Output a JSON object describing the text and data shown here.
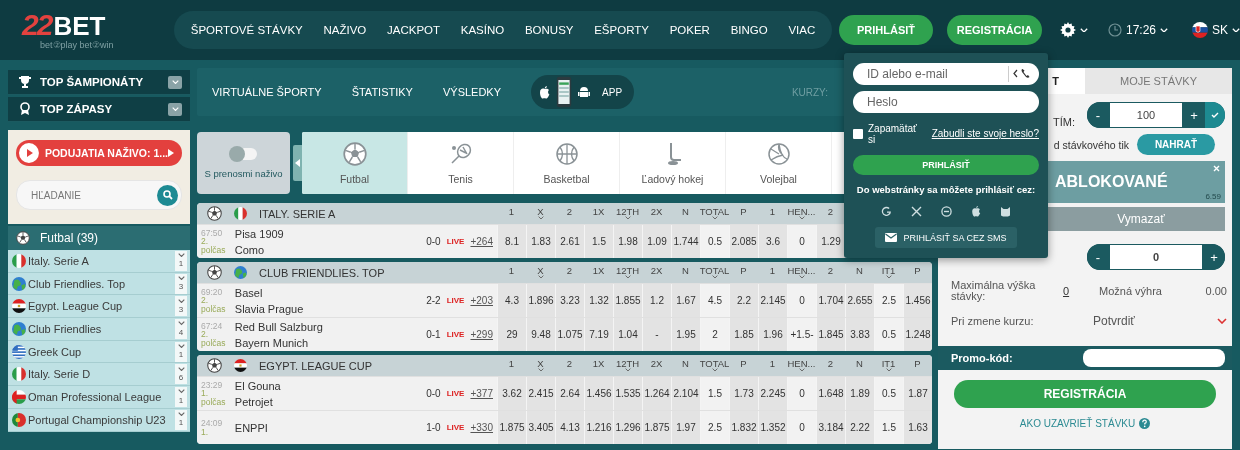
{
  "header": {
    "logo": {
      "mark": "22",
      "name": "BET",
      "tagline": "bet②play bet②win"
    },
    "nav": [
      "ŠPORTOVÉ STÁVKY",
      "NAŽIVO",
      "JACKPOT",
      "KASÍNO",
      "BONUSY",
      "EŠPORTY",
      "POKER",
      "BINGO",
      "VIAC"
    ],
    "login_button": "PRIHLÁSIŤ",
    "register_button": "REGISTRÁCIA",
    "time": "17:26",
    "language": "SK"
  },
  "login_popup": {
    "id_placeholder": "ID alebo e-mail",
    "password_placeholder": "Heslo",
    "remember": {
      "label": "Zapamätať si",
      "checked": false
    },
    "forgot_link": "Zabudli ste svoje heslo?",
    "submit": "PRIHLÁSIŤ",
    "social_caption": "Do webstránky sa môžete prihlásiť cez:",
    "sms_button": "PRIHLÁSIŤ SA CEZ SMS"
  },
  "sidebar": {
    "top": [
      {
        "label": "TOP ŠAMPIONÁTY",
        "kind": "trophy"
      },
      {
        "label": "TOP ZÁPASY",
        "kind": "medal"
      }
    ],
    "live_button": "PODUJATIA NAŽIVO: 1...",
    "search": {
      "placeholder": "HĽADANIE"
    },
    "sport": "Futbal (39)",
    "leagues": [
      {
        "name": "Italy. Serie A",
        "kind": "italy",
        "count": "1"
      },
      {
        "name": "Club Friendlies. Top",
        "kind": "world",
        "count": "3"
      },
      {
        "name": "Egypt. League Cup",
        "kind": "egypt",
        "count": "3"
      },
      {
        "name": "Club Friendlies",
        "kind": "world",
        "count": "4"
      },
      {
        "name": "Greek Cup",
        "kind": "greece",
        "count": "1"
      },
      {
        "name": "Italy. Serie D",
        "kind": "italy",
        "count": "6"
      },
      {
        "name": "Oman Professional League",
        "kind": "oman",
        "count": "1"
      },
      {
        "name": "Portugal Championship U23",
        "kind": "portugal",
        "count": "1"
      }
    ]
  },
  "subnav": {
    "links": [
      "VIRTUÁLNE ŠPORTY",
      "ŠTATISTIKY",
      "VÝSLEDKY"
    ],
    "app": "APP",
    "odds_label": "KURZY:"
  },
  "sports": {
    "live_toggle": {
      "label": "S prenosmi naživo",
      "on": false
    },
    "tabs": [
      {
        "label": "Futbal",
        "kind": "soccer",
        "selected": true
      },
      {
        "label": "Tenis",
        "kind": "tennis",
        "selected": false
      },
      {
        "label": "Basketbal",
        "kind": "basketball",
        "selected": false
      },
      {
        "label": "Ľadový hokej",
        "kind": "hockey",
        "selected": false
      },
      {
        "label": "Volejbal",
        "kind": "volleyball",
        "selected": false
      }
    ]
  },
  "groups": [
    {
      "name": "ITALY. SERIE A",
      "kind": "italy",
      "columns": [
        {
          "label": "1",
          "dropdown": false,
          "kind": "odds"
        },
        {
          "label": "X",
          "dropdown": true,
          "kind": "odds"
        },
        {
          "label": "2",
          "dropdown": false,
          "kind": "odds"
        },
        {
          "label": "1X",
          "dropdown": false,
          "kind": "odds"
        },
        {
          "label": "12TH",
          "dropdown": true,
          "kind": "odds"
        },
        {
          "label": "2X",
          "dropdown": false,
          "kind": "odds"
        },
        {
          "label": "N",
          "dropdown": false,
          "kind": "odds"
        },
        {
          "label": "TOTAL",
          "dropdown": true,
          "kind": "param"
        },
        {
          "label": "P",
          "dropdown": false,
          "kind": "odds"
        },
        {
          "label": "1",
          "dropdown": false,
          "kind": "odds"
        },
        {
          "label": "HEN...",
          "dropdown": true,
          "kind": "param"
        },
        {
          "label": "2",
          "dropdown": false,
          "kind": "odds"
        }
      ],
      "matches": [
        {
          "time": "67:50",
          "period": "2. polčas",
          "home": "Pisa 1909",
          "away": "Como",
          "score": "0-0",
          "live": "LIVE",
          "markets": "+264",
          "odds": [
            "8.1",
            "1.83",
            "2.61",
            "1.5",
            "1.98",
            "1.09",
            "1.744",
            "0.5",
            "2.085",
            "3.6",
            "0",
            "1.29"
          ]
        }
      ]
    },
    {
      "name": "CLUB FRIENDLIES. TOP",
      "kind": "world",
      "columns": [
        {
          "label": "1",
          "dropdown": false,
          "kind": "odds"
        },
        {
          "label": "X",
          "dropdown": true,
          "kind": "odds"
        },
        {
          "label": "2",
          "dropdown": false,
          "kind": "odds"
        },
        {
          "label": "1X",
          "dropdown": false,
          "kind": "odds"
        },
        {
          "label": "12TH",
          "dropdown": true,
          "kind": "odds"
        },
        {
          "label": "2X",
          "dropdown": false,
          "kind": "odds"
        },
        {
          "label": "N",
          "dropdown": false,
          "kind": "odds"
        },
        {
          "label": "TOTAL",
          "dropdown": true,
          "kind": "param"
        },
        {
          "label": "P",
          "dropdown": false,
          "kind": "odds"
        },
        {
          "label": "1",
          "dropdown": false,
          "kind": "odds"
        },
        {
          "label": "HEN...",
          "dropdown": true,
          "kind": "param"
        },
        {
          "label": "2",
          "dropdown": false,
          "kind": "odds"
        },
        {
          "label": "N",
          "dropdown": false,
          "kind": "odds"
        },
        {
          "label": "IT1",
          "dropdown": true,
          "kind": "param"
        },
        {
          "label": "P",
          "dropdown": false,
          "kind": "odds"
        }
      ],
      "matches": [
        {
          "time": "69:20",
          "period": "2. polčas",
          "home": "Basel",
          "away": "Slavia Prague",
          "score": "2-2",
          "live": "LIVE",
          "markets": "+203",
          "odds": [
            "4.3",
            "1.896",
            "3.23",
            "1.32",
            "1.855",
            "1.2",
            "1.67",
            "4.5",
            "2.2",
            "2.145",
            "0",
            "1.704",
            "2.655",
            "2.5",
            "1.456"
          ]
        },
        {
          "time": "67:24",
          "period": "2. polčas",
          "home": "Red Bull Salzburg",
          "away": "Bayern Munich",
          "score": "0-1",
          "live": "LIVE",
          "markets": "+299",
          "odds": [
            "29",
            "9.48",
            "1.075",
            "7.19",
            "1.04",
            "-",
            "1.95",
            "2",
            "1.85",
            "1.96",
            "+1.5-",
            "1.845",
            "3.83",
            "0.5",
            "1.248"
          ]
        }
      ]
    },
    {
      "name": "EGYPT. LEAGUE CUP",
      "kind": "egypt",
      "columns": [
        {
          "label": "1",
          "dropdown": false,
          "kind": "odds"
        },
        {
          "label": "X",
          "dropdown": true,
          "kind": "odds"
        },
        {
          "label": "2",
          "dropdown": false,
          "kind": "odds"
        },
        {
          "label": "1X",
          "dropdown": false,
          "kind": "odds"
        },
        {
          "label": "12TH",
          "dropdown": true,
          "kind": "odds"
        },
        {
          "label": "2X",
          "dropdown": false,
          "kind": "odds"
        },
        {
          "label": "N",
          "dropdown": false,
          "kind": "odds"
        },
        {
          "label": "TOTAL",
          "dropdown": true,
          "kind": "param"
        },
        {
          "label": "P",
          "dropdown": false,
          "kind": "odds"
        },
        {
          "label": "1",
          "dropdown": false,
          "kind": "odds"
        },
        {
          "label": "HEN...",
          "dropdown": true,
          "kind": "param"
        },
        {
          "label": "2",
          "dropdown": false,
          "kind": "odds"
        },
        {
          "label": "N",
          "dropdown": false,
          "kind": "odds"
        },
        {
          "label": "IT1",
          "dropdown": true,
          "kind": "param"
        },
        {
          "label": "P",
          "dropdown": false,
          "kind": "odds"
        }
      ],
      "matches": [
        {
          "time": "23:29",
          "period": "1. polčas",
          "home": "El Gouna",
          "away": "Petrojet",
          "score": "0-0",
          "live": "LIVE",
          "markets": "+377",
          "odds": [
            "3.62",
            "2.415",
            "2.64",
            "1.456",
            "1.535",
            "1.264",
            "2.104",
            "1.5",
            "1.73",
            "2.245",
            "0",
            "1.648",
            "1.89",
            "0.5",
            "1.87"
          ]
        },
        {
          "time": "24:09",
          "period": "1.",
          "home": "ENPPI",
          "score": "1-0",
          "live": "LIVE",
          "markets": "+330",
          "odds": [
            "1.875",
            "3.405",
            "4.13",
            "1.216",
            "1.296",
            "1.875",
            "1.97",
            "2.5",
            "1.832",
            "1.352",
            "0",
            "3.184",
            "2.22",
            "1.5",
            "1.63"
          ]
        }
      ]
    }
  ],
  "betslip": {
    "tabs": [
      {
        "label": "T",
        "selected": true
      },
      {
        "label": "MOJE STÁVKY",
        "selected": false
      }
    ],
    "stake_label": "TÍM:",
    "stake_minus": "-",
    "stake_value": "100",
    "stake_plus": "+",
    "upload_label": "d stávkového tik",
    "upload_button": "NAHRAŤ",
    "blocked_status": "ABLOKOVANÉ",
    "blocked_odds": "6.59",
    "clear_button": "Vymazať",
    "amount_minus": "-",
    "amount_value": "0",
    "amount_plus": "+",
    "max_label": "Maximálna výška stávky:",
    "max_value": "0",
    "win_label": "Možná výhra",
    "win_value": "0.00",
    "change_label": "Pri zmene kurzu:",
    "change_value": "Potvrdiť",
    "promo_label": "Promo-kód:",
    "register_button": "REGISTRÁCIA",
    "help_link": "AKO UZAVRIEŤ STÁVKU"
  }
}
